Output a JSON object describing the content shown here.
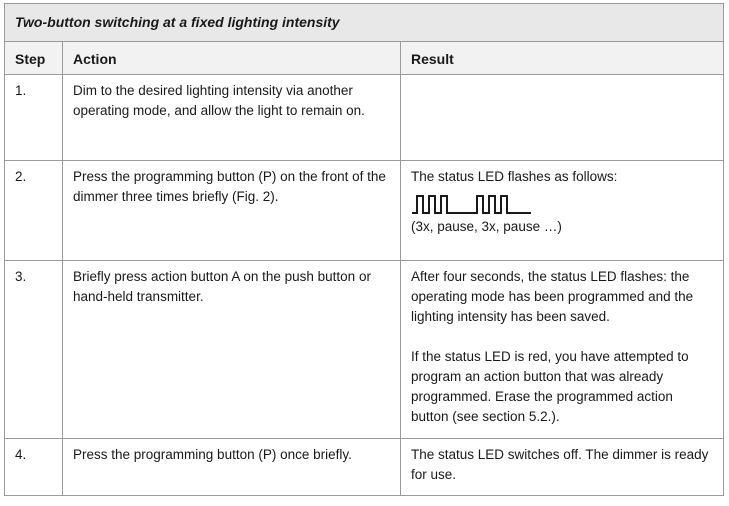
{
  "title": "Two-button switching at a fixed lighting intensity",
  "headers": {
    "step": "Step",
    "action": "Action",
    "result": "Result"
  },
  "rows": [
    {
      "step": "1.",
      "action": "Dim to the desired lighting intensity via another operating mode, and allow the light to remain on.",
      "result": ""
    },
    {
      "step": "2.",
      "action": "Press the programming button (P) on the front of the dimmer three times briefly (Fig. 2).",
      "result": "The status LED flashes as follows:",
      "pulse_caption": "(3x, pause, 3x, pause …)",
      "pulse_pattern": [
        3,
        "pause",
        3,
        "pause"
      ]
    },
    {
      "step": "3.",
      "action": "Briefly press action button A on the push button or hand-held transmitter.",
      "result": "After four seconds, the status LED flashes: the operating mode has been programmed and the lighting intensity has been saved.",
      "result_extra": "If the status LED is red, you have attempted to program an action button that was already programmed. Erase the programmed action button (see section 5.2.)."
    },
    {
      "step": "4.",
      "action": "Press the programming button (P) once briefly.",
      "result": "The status LED switches off. The dimmer is ready for use."
    }
  ]
}
